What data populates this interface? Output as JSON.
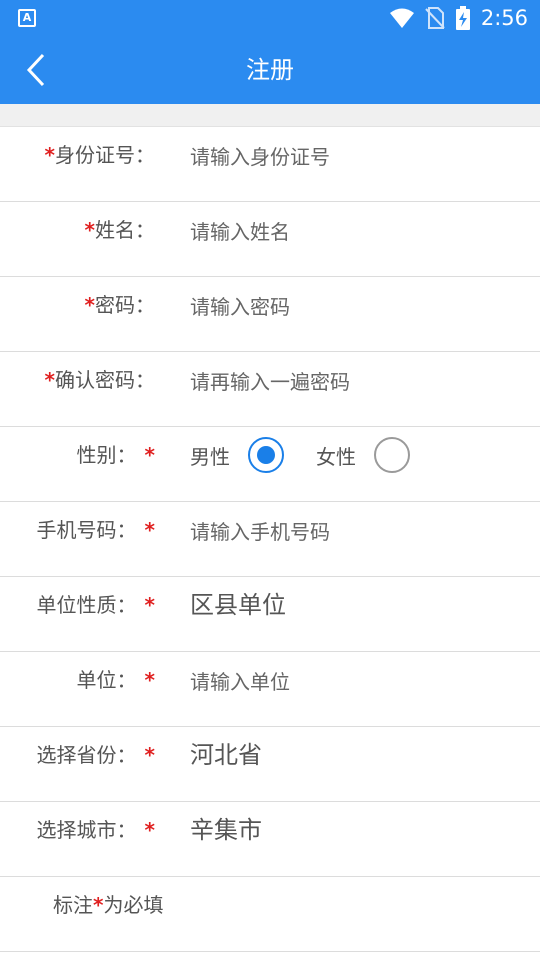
{
  "statusbar": {
    "time": "2:56",
    "app_icon": "A"
  },
  "header": {
    "title": "注册",
    "back_icon": "chevron-left-icon"
  },
  "form": {
    "id_card": {
      "label": "身份证号：",
      "placeholder": "请输入身份证号",
      "required": true
    },
    "name": {
      "label": "姓名：",
      "placeholder": "请输入姓名",
      "required": true
    },
    "password": {
      "label": "密码：",
      "placeholder": "请输入密码",
      "required": true
    },
    "confirm_password": {
      "label": "确认密码：",
      "placeholder": "请再输入一遍密码",
      "required": true
    },
    "gender": {
      "label": "性别：",
      "options": [
        "男性",
        "女性"
      ],
      "selected": "男性"
    },
    "phone": {
      "label": "手机号码：",
      "placeholder": "请输入手机号码"
    },
    "unit_type": {
      "label": "单位性质：",
      "value": "区县单位"
    },
    "unit": {
      "label": "单位：",
      "placeholder": "请输入单位"
    },
    "province": {
      "label": "选择省份：",
      "value": "河北省"
    },
    "city": {
      "label": "选择城市：",
      "value": "辛集市"
    },
    "note": {
      "prefix": "标注",
      "star": "*",
      "suffix": "为必填"
    },
    "star": "*"
  },
  "colors": {
    "primary": "#2b8bf0",
    "required": "#e02020",
    "radio": "#1a7fe8"
  }
}
